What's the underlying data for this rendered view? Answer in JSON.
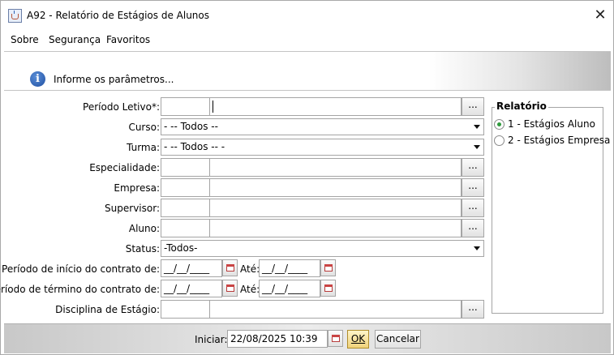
{
  "window": {
    "title": "A92 - Relatório de Estágios de Alunos"
  },
  "menu": {
    "items": [
      "Sobre",
      "Segurança",
      "Favoritos"
    ]
  },
  "header": {
    "message": "Informe os parâmetros..."
  },
  "form": {
    "periodo_letivo": {
      "label": "Período Letivo*:",
      "code": "",
      "desc": "",
      "button": "..."
    },
    "curso": {
      "label": "Curso:",
      "value": "- -- Todos --"
    },
    "turma": {
      "label": "Turma:",
      "value": "- -- Todos -- -"
    },
    "especialidade": {
      "label": "Especialidade:",
      "code": "",
      "desc": "",
      "button": "..."
    },
    "empresa": {
      "label": "Empresa:",
      "code": "",
      "desc": "",
      "button": "..."
    },
    "supervisor": {
      "label": "Supervisor:",
      "code": "",
      "desc": "",
      "button": "..."
    },
    "aluno": {
      "label": "Aluno:",
      "code": "",
      "desc": "",
      "button": "..."
    },
    "status": {
      "label": "Status:",
      "value": "-Todos-"
    },
    "inicio_contrato": {
      "label": "Período de início do contrato de:",
      "from": "__/__/____",
      "ate_label": "Até:",
      "to": "__/__/____"
    },
    "termino_contrato": {
      "label": "Período de término do contrato de:",
      "from": "__/__/____",
      "ate_label": "Até:",
      "to": "__/__/____"
    },
    "disciplina": {
      "label": "Disciplina de Estágio:",
      "code": "",
      "desc": "",
      "button": "..."
    }
  },
  "relatorio": {
    "title": "Relatório",
    "options": [
      {
        "label": "1  -  Estágios Aluno",
        "selected": true
      },
      {
        "label": "2  -  Estágios Empresa",
        "selected": false
      }
    ]
  },
  "footer": {
    "iniciar_label": "Iniciar:",
    "iniciar_value": "22/08/2025 10:39",
    "ok_label": "OK",
    "cancel_label": "Cancelar"
  }
}
